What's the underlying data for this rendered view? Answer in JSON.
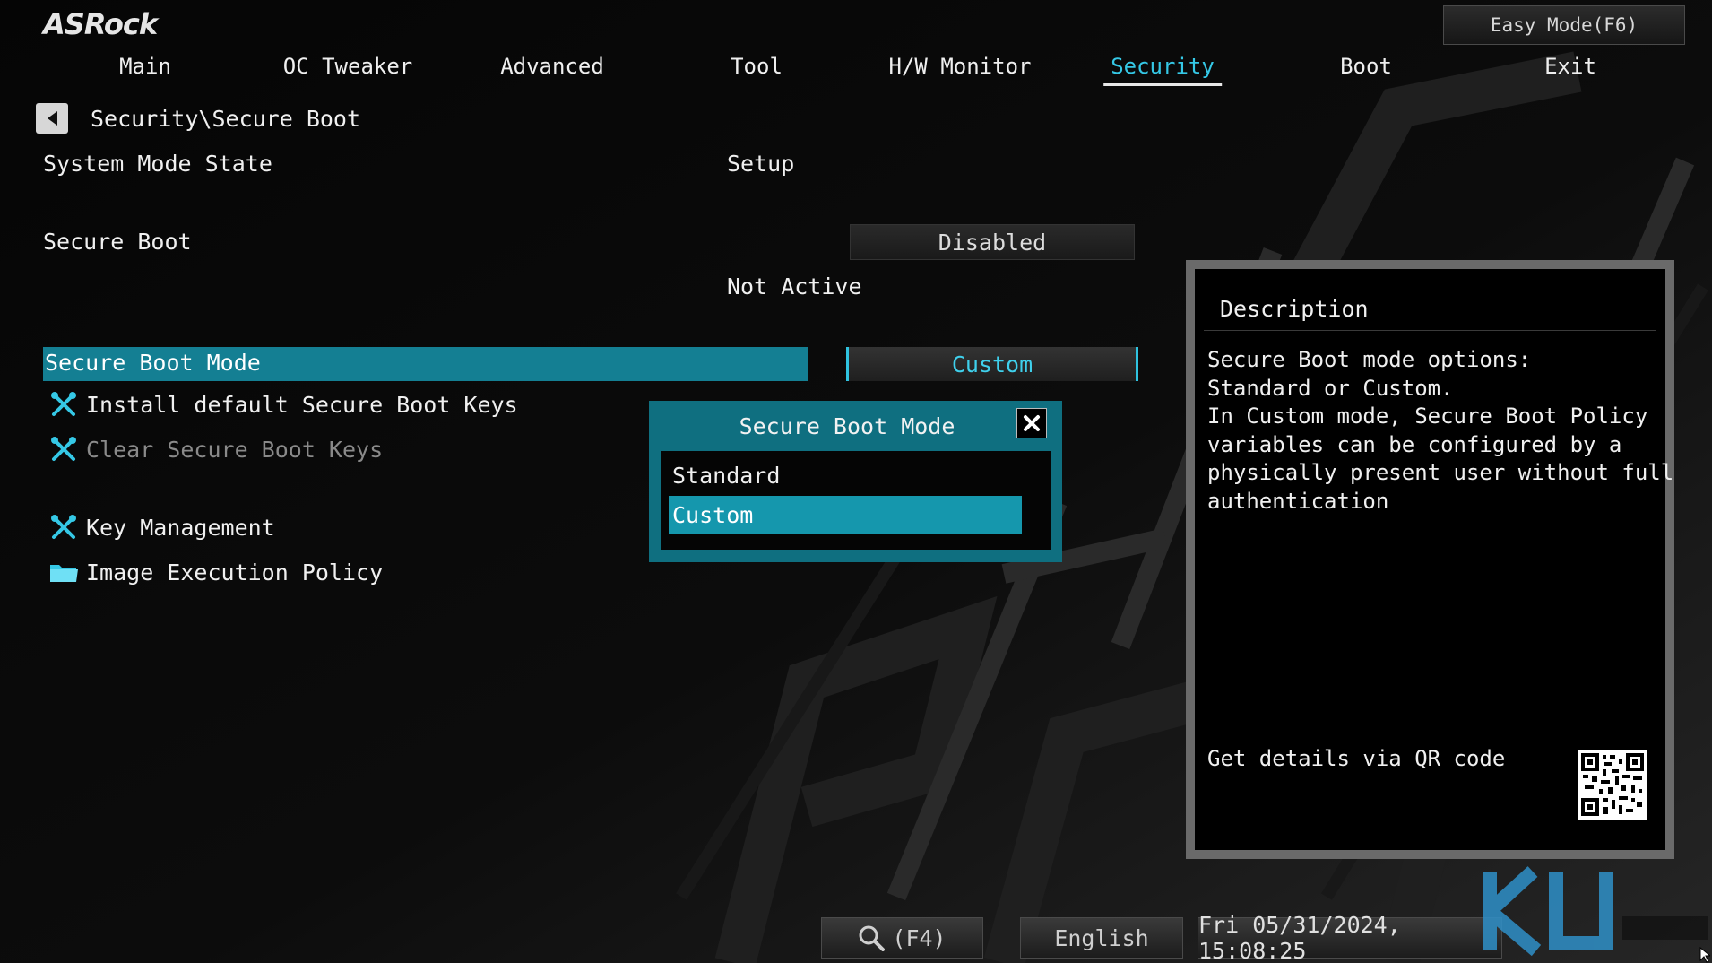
{
  "brand": {
    "logo_text": "ASRock"
  },
  "header": {
    "easy_mode_label": "Easy Mode(F6)",
    "tabs": [
      {
        "label": "Main",
        "active": false
      },
      {
        "label": "OC Tweaker",
        "active": false
      },
      {
        "label": "Advanced",
        "active": false
      },
      {
        "label": "Tool",
        "active": false
      },
      {
        "label": "H/W Monitor",
        "active": false
      },
      {
        "label": "Security",
        "active": true
      },
      {
        "label": "Boot",
        "active": false
      },
      {
        "label": "Exit",
        "active": false
      }
    ]
  },
  "breadcrumb": {
    "path": "Security\\Secure Boot"
  },
  "settings": {
    "system_mode_label": "System Mode State",
    "system_mode_value": "Setup",
    "secure_boot_label": "Secure Boot",
    "secure_boot_value": "Disabled",
    "secure_boot_status": "Not Active",
    "secure_boot_mode_label": "Secure Boot Mode",
    "secure_boot_mode_value": "Custom"
  },
  "menu_items": [
    {
      "label": "Install default Secure Boot Keys",
      "icon": "tools-icon",
      "enabled": true
    },
    {
      "label": "Clear Secure Boot Keys",
      "icon": "tools-icon",
      "enabled": false
    },
    {
      "label": "Key Management",
      "icon": "tools-icon",
      "enabled": true
    },
    {
      "label": "Image Execution Policy",
      "icon": "folder-icon",
      "enabled": true
    }
  ],
  "popup": {
    "title": "Secure Boot Mode",
    "options": [
      {
        "label": "Standard",
        "selected": false
      },
      {
        "label": "Custom",
        "selected": true
      }
    ]
  },
  "description": {
    "title": "Description",
    "lines": [
      "Secure Boot mode options:",
      "Standard or Custom.",
      "In Custom mode, Secure Boot Policy",
      "variables can be configured by a",
      "physically present user without full",
      "authentication"
    ],
    "qr_label": "Get details via QR code"
  },
  "footer": {
    "search_label": "(F4)",
    "language": "English",
    "datetime": "Fri 05/31/2024, 15:08:25"
  },
  "colors": {
    "accent": "#35c8e6",
    "highlight": "#147f93",
    "popup": "#0f6f80"
  }
}
